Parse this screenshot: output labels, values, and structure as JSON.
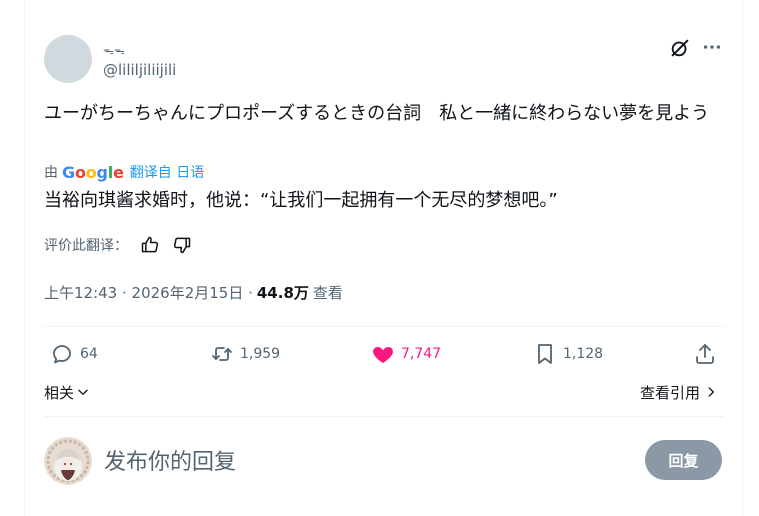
{
  "author": {
    "display_name": "ᯓᯓ",
    "handle": "@lililjiliijili"
  },
  "header": {
    "grok_icon": "grok-icon",
    "more_icon": "more-dots-icon"
  },
  "tweet": {
    "text": "ユーがちーちゃんにプロポーズするときの台詞　私と一緒に終わらない夢を見よう",
    "translation": {
      "by_label": "由",
      "provider": "Google",
      "translated_from": "翻译自 日语",
      "text": "当裕向琪酱求婚时，他说：“让我们一起拥有一个无尽的梦想吧。”"
    },
    "rate_translation_label": "评价此翻译：",
    "timestamp": "上午12:43 · 2026年2月15日 · ",
    "views_count": "44.8万",
    "views_label": "查看"
  },
  "actions": {
    "replies": "64",
    "retweets": "1,959",
    "likes": "7,747",
    "bookmarks": "1,128"
  },
  "related_label": "相关",
  "view_quotes_label": "查看引用",
  "reply": {
    "placeholder": "发布你的回复",
    "button_label": "回复"
  },
  "colors": {
    "accent": "#1d9bf0",
    "like": "#f91880",
    "muted": "#536471",
    "text": "#0f1419",
    "reply_button": "#8b98a5"
  }
}
